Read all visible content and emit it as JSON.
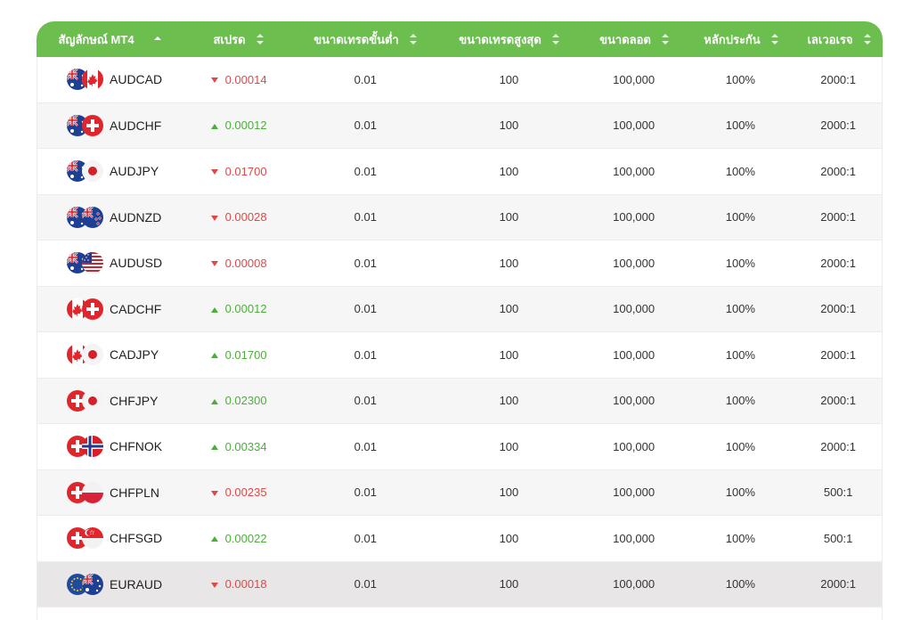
{
  "header": {
    "symbol": "สัญลักษณ์ MT4",
    "spread": "สเปรด",
    "min_trade": "ขนาดเทรดขั้นต่ำ",
    "max_trade": "ขนาดเทรดสูงสุด",
    "lot_size": "ขนาดลอต",
    "margin": "หลักประกัน",
    "leverage": "เลเวอเรจ"
  },
  "colors": {
    "header_bg": "#6cbf4f",
    "spread_up": "#4cae3a",
    "spread_down": "#e04848"
  },
  "rows": [
    {
      "symbol": "AUDCAD",
      "spread": "0.00014",
      "dir": "down",
      "min": "0.01",
      "max": "100",
      "lot": "100,000",
      "margin": "100%",
      "leverage": "2000:1",
      "flags": [
        "AU",
        "CA"
      ]
    },
    {
      "symbol": "AUDCHF",
      "spread": "0.00012",
      "dir": "up",
      "min": "0.01",
      "max": "100",
      "lot": "100,000",
      "margin": "100%",
      "leverage": "2000:1",
      "flags": [
        "AU",
        "CH"
      ]
    },
    {
      "symbol": "AUDJPY",
      "spread": "0.01700",
      "dir": "down",
      "min": "0.01",
      "max": "100",
      "lot": "100,000",
      "margin": "100%",
      "leverage": "2000:1",
      "flags": [
        "AU",
        "JP"
      ]
    },
    {
      "symbol": "AUDNZD",
      "spread": "0.00028",
      "dir": "down",
      "min": "0.01",
      "max": "100",
      "lot": "100,000",
      "margin": "100%",
      "leverage": "2000:1",
      "flags": [
        "AU",
        "NZ"
      ]
    },
    {
      "symbol": "AUDUSD",
      "spread": "0.00008",
      "dir": "down",
      "min": "0.01",
      "max": "100",
      "lot": "100,000",
      "margin": "100%",
      "leverage": "2000:1",
      "flags": [
        "AU",
        "US"
      ]
    },
    {
      "symbol": "CADCHF",
      "spread": "0.00012",
      "dir": "up",
      "min": "0.01",
      "max": "100",
      "lot": "100,000",
      "margin": "100%",
      "leverage": "2000:1",
      "flags": [
        "CA",
        "CH"
      ]
    },
    {
      "symbol": "CADJPY",
      "spread": "0.01700",
      "dir": "up",
      "min": "0.01",
      "max": "100",
      "lot": "100,000",
      "margin": "100%",
      "leverage": "2000:1",
      "flags": [
        "CA",
        "JP"
      ]
    },
    {
      "symbol": "CHFJPY",
      "spread": "0.02300",
      "dir": "up",
      "min": "0.01",
      "max": "100",
      "lot": "100,000",
      "margin": "100%",
      "leverage": "2000:1",
      "flags": [
        "CH",
        "JP"
      ]
    },
    {
      "symbol": "CHFNOK",
      "spread": "0.00334",
      "dir": "up",
      "min": "0.01",
      "max": "100",
      "lot": "100,000",
      "margin": "100%",
      "leverage": "2000:1",
      "flags": [
        "CH",
        "NO"
      ]
    },
    {
      "symbol": "CHFPLN",
      "spread": "0.00235",
      "dir": "down",
      "min": "0.01",
      "max": "100",
      "lot": "100,000",
      "margin": "100%",
      "leverage": "500:1",
      "flags": [
        "CH",
        "PL"
      ]
    },
    {
      "symbol": "CHFSGD",
      "spread": "0.00022",
      "dir": "up",
      "min": "0.01",
      "max": "100",
      "lot": "100,000",
      "margin": "100%",
      "leverage": "500:1",
      "flags": [
        "CH",
        "SG"
      ]
    },
    {
      "symbol": "EURAUD",
      "spread": "0.00018",
      "dir": "down",
      "min": "0.01",
      "max": "100",
      "lot": "100,000",
      "margin": "100%",
      "leverage": "2000:1",
      "flags": [
        "EU",
        "AU"
      ]
    }
  ]
}
